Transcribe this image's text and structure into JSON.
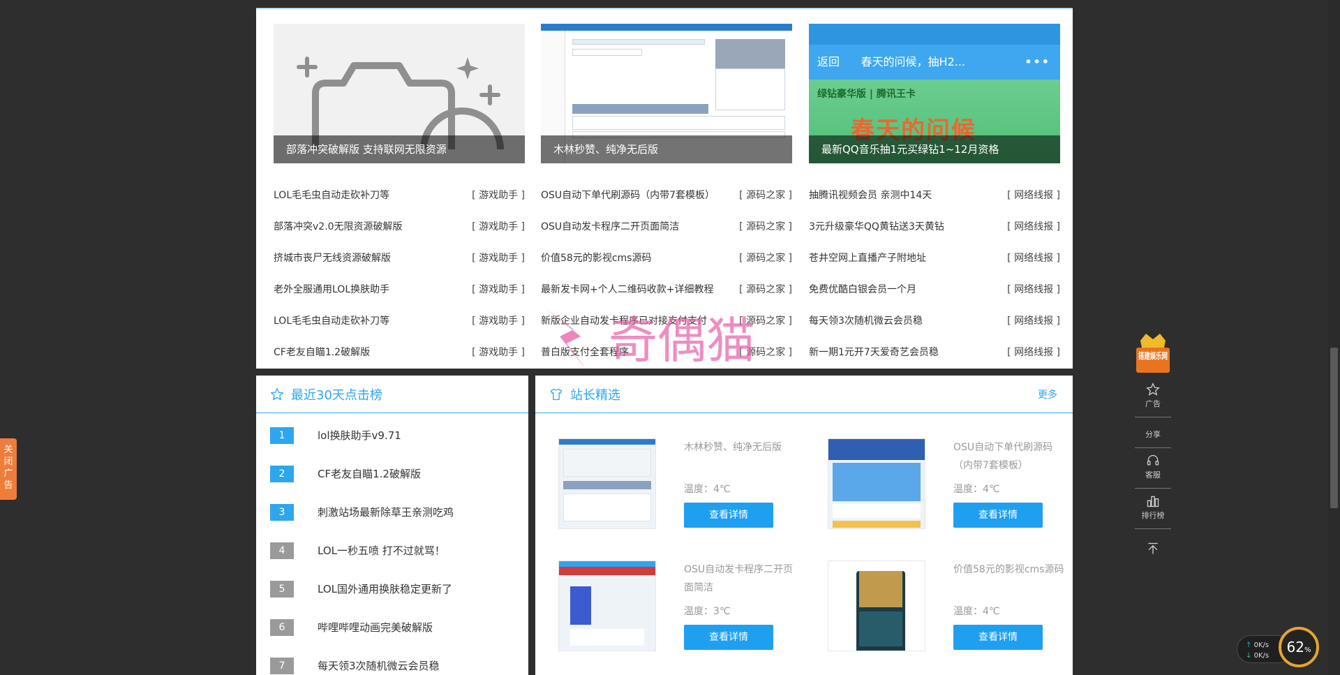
{
  "featured": [
    {
      "caption": "部落冲突破解版 支持联网无限资源",
      "image": "camera-placeholder-icon"
    },
    {
      "caption": "木林秒赞、纯净无后版",
      "image": "admin-screenshot"
    },
    {
      "caption": "最新QQ音乐抽1元买绿钻1~12月资格",
      "image": "qq-promo-screenshot",
      "qq_nav_back": "返回",
      "qq_nav_title": "春天的问候，抽H2...",
      "qq_badge": "绿钻豪华版 | 腾讯王卡",
      "qq_big": "春天的问候"
    }
  ],
  "lists": [
    [
      {
        "title": "LOL毛毛虫自动走砍补刀等",
        "tag": "[ 游戏助手 ]"
      },
      {
        "title": "部落冲突v2.0无限资源破解版",
        "tag": "[ 游戏助手 ]"
      },
      {
        "title": "挤城市丧尸无线资源破解版",
        "tag": "[ 游戏助手 ]"
      },
      {
        "title": "老外全服通用LOL换肤助手",
        "tag": "[ 游戏助手 ]"
      },
      {
        "title": "LOL毛毛虫自动走砍补刀等",
        "tag": "[ 游戏助手 ]"
      },
      {
        "title": "CF老友自瞄1.2破解版",
        "tag": "[ 游戏助手 ]"
      }
    ],
    [
      {
        "title": "OSU自动下单代刷源码（内带7套模板）",
        "tag": "[ 源码之家 ]"
      },
      {
        "title": "OSU自动发卡程序二开页面简洁",
        "tag": "[ 源码之家 ]"
      },
      {
        "title": "价值58元的影视cms源码",
        "tag": "[ 源码之家 ]"
      },
      {
        "title": "最新发卡网+个人二维码收款+详细教程",
        "tag": "[ 源码之家 ]"
      },
      {
        "title": "新版企业自动发卡程序已对接支付支付",
        "tag": "[ 源码之家 ]"
      },
      {
        "title": "普白版支付全套程序",
        "tag": "[ 源码之家 ]"
      }
    ],
    [
      {
        "title": "抽腾讯视频会员 亲测中14天",
        "tag": "[ 网络线报 ]"
      },
      {
        "title": "3元升级豪华QQ黄钻送3天黄钻",
        "tag": "[ 网络线报 ]"
      },
      {
        "title": "苍井空网上直播产子附地址",
        "tag": "[ 网络线报 ]"
      },
      {
        "title": "免费优酷白银会员一个月",
        "tag": "[ 网络线报 ]"
      },
      {
        "title": "每天领3次随机微云会员稳",
        "tag": "[ 网络线报 ]"
      },
      {
        "title": "新一期1元开7天爱奇艺会员稳",
        "tag": "[ 网络线报 ]"
      }
    ]
  ],
  "ranking": {
    "title": "最近30天点击榜",
    "items": [
      {
        "num": "1",
        "text": "lol换肤助手v9.71"
      },
      {
        "num": "2",
        "text": "CF老友自瞄1.2破解版"
      },
      {
        "num": "3",
        "text": "刺激站场最新除草王亲测吃鸡"
      },
      {
        "num": "4",
        "text": "LOL一秒五喷 打不过就骂！"
      },
      {
        "num": "5",
        "text": "LOL国外通用换肤稳定更新了"
      },
      {
        "num": "6",
        "text": "哔哩哔哩动画完美破解版"
      },
      {
        "num": "7",
        "text": "每天领3次随机微云会员稳"
      }
    ]
  },
  "picks": {
    "title": "站长精选",
    "more": "更多",
    "items": [
      {
        "title": "木林秒赞、纯净无后版",
        "temp": "温度：4℃",
        "button": "查看详情"
      },
      {
        "title": "OSU自动下单代刷源码（内带7套模板）",
        "temp": "温度：4℃",
        "button": "查看详情"
      },
      {
        "title": "OSU自动发卡程序二开页面简洁",
        "temp": "温度：3℃",
        "button": "查看详情"
      },
      {
        "title": "价值58元的影视cms源码",
        "temp": "温度：4℃",
        "button": "查看详情"
      }
    ]
  },
  "watermark": "奇偶猫",
  "close_ad": "关闭广告",
  "sidebar": {
    "crown_text": "搭建娱乐网",
    "ad": "广告",
    "share": "分享",
    "service": "客服",
    "rank": "排行榜"
  },
  "speed": {
    "up": "0K/s",
    "down": "0K/s",
    "percent": "62"
  },
  "colors": {
    "accent": "#2da6ee",
    "button": "#1f9ff0",
    "rank_gray": "#9a9a9a",
    "ad_tab": "#ef7d3a",
    "dark_bg": "#2e2e2e"
  }
}
